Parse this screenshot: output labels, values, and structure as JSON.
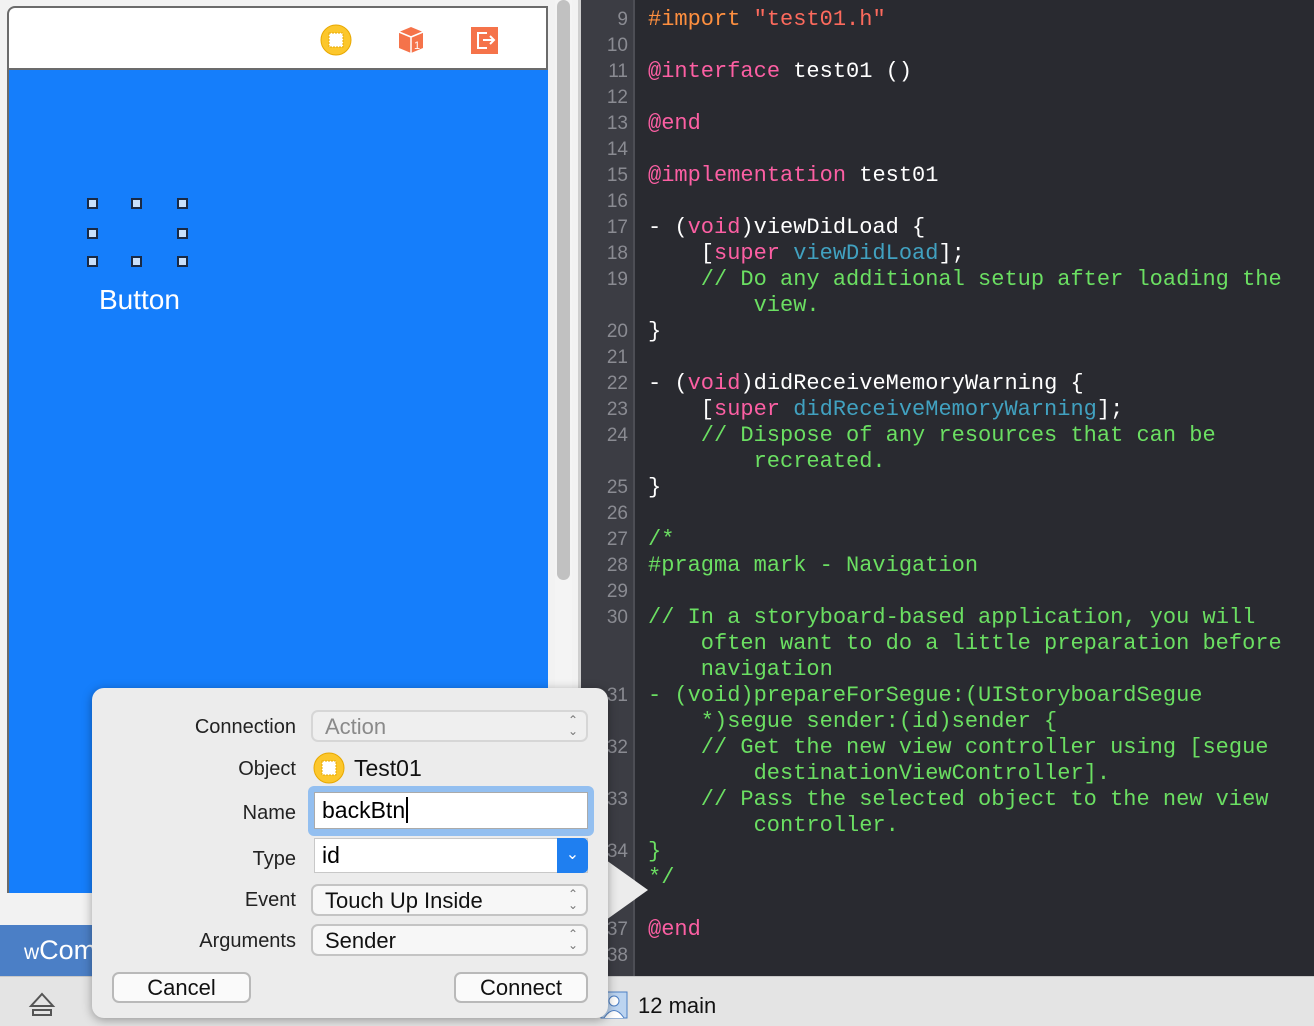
{
  "canvas": {
    "button_label": "Button",
    "scene_icons": [
      "view-controller-icon",
      "first-responder-icon",
      "exit-icon"
    ],
    "view_color": "#157efb"
  },
  "bottom_left": {
    "label_prefix": "w",
    "label": "Com"
  },
  "status_bar": {
    "branch_label": "12 main"
  },
  "popover": {
    "connection": {
      "label": "Connection",
      "value": "Action"
    },
    "object": {
      "label": "Object",
      "value": "Test01"
    },
    "name": {
      "label": "Name",
      "value": "backBtn"
    },
    "type": {
      "label": "Type",
      "value": "id"
    },
    "event": {
      "label": "Event",
      "value": "Touch Up Inside"
    },
    "arguments": {
      "label": "Arguments",
      "value": "Sender"
    },
    "cancel_label": "Cancel",
    "connect_label": "Connect"
  },
  "colors": {
    "keyword": "#fc5fa3",
    "string": "#fc6a5d",
    "preproc": "#fd8f3f",
    "comment": "#6bdf62",
    "method": "#41a1c0",
    "plain": "#ffffff"
  },
  "code_rows": [
    {
      "n": "9",
      "indent": 0,
      "t": [
        [
          "#import ",
          "preproc"
        ],
        [
          "\"test01.h\"",
          "string"
        ]
      ]
    },
    {
      "n": "10",
      "indent": 0,
      "t": []
    },
    {
      "n": "11",
      "indent": 0,
      "t": [
        [
          "@interface",
          "keyword"
        ],
        [
          " test01 ()",
          "plain"
        ]
      ]
    },
    {
      "n": "12",
      "indent": 0,
      "t": []
    },
    {
      "n": "13",
      "indent": 0,
      "t": [
        [
          "@end",
          "keyword"
        ]
      ]
    },
    {
      "n": "14",
      "indent": 0,
      "t": []
    },
    {
      "n": "15",
      "indent": 0,
      "t": [
        [
          "@implementation",
          "keyword"
        ],
        [
          " test01",
          "plain"
        ]
      ]
    },
    {
      "n": "16",
      "indent": 0,
      "t": []
    },
    {
      "n": "17",
      "indent": 0,
      "t": [
        [
          "- (",
          "plain"
        ],
        [
          "void",
          "keyword"
        ],
        [
          ")viewDidLoad {",
          "plain"
        ]
      ]
    },
    {
      "n": "18",
      "indent": 4,
      "t": [
        [
          "[",
          "plain"
        ],
        [
          "super",
          "keyword"
        ],
        [
          " ",
          "plain"
        ],
        [
          "viewDidLoad",
          "method"
        ],
        [
          "];",
          "plain"
        ]
      ]
    },
    {
      "n": "19",
      "indent": 4,
      "t": [
        [
          "// Do any additional setup after loading the",
          "comment"
        ]
      ]
    },
    {
      "n": "",
      "indent": 8,
      "t": [
        [
          "view.",
          "comment"
        ]
      ]
    },
    {
      "n": "20",
      "indent": 0,
      "t": [
        [
          "}",
          "plain"
        ]
      ]
    },
    {
      "n": "21",
      "indent": 0,
      "t": []
    },
    {
      "n": "22",
      "indent": 0,
      "t": [
        [
          "- (",
          "plain"
        ],
        [
          "void",
          "keyword"
        ],
        [
          ")didReceiveMemoryWarning {",
          "plain"
        ]
      ]
    },
    {
      "n": "23",
      "indent": 4,
      "t": [
        [
          "[",
          "plain"
        ],
        [
          "super",
          "keyword"
        ],
        [
          " ",
          "plain"
        ],
        [
          "didReceiveMemoryWarning",
          "method"
        ],
        [
          "];",
          "plain"
        ]
      ]
    },
    {
      "n": "24",
      "indent": 4,
      "t": [
        [
          "// Dispose of any resources that can be",
          "comment"
        ]
      ]
    },
    {
      "n": "",
      "indent": 8,
      "t": [
        [
          "recreated.",
          "comment"
        ]
      ]
    },
    {
      "n": "25",
      "indent": 0,
      "t": [
        [
          "}",
          "plain"
        ]
      ]
    },
    {
      "n": "26",
      "indent": 0,
      "t": []
    },
    {
      "n": "27",
      "indent": 0,
      "t": [
        [
          "/*",
          "comment"
        ]
      ]
    },
    {
      "n": "28",
      "indent": 0,
      "t": [
        [
          "#pragma mark - Navigation",
          "comment"
        ]
      ]
    },
    {
      "n": "29",
      "indent": 0,
      "t": []
    },
    {
      "n": "30",
      "indent": 0,
      "t": [
        [
          "// In a storyboard-based application, you will",
          "comment"
        ]
      ]
    },
    {
      "n": "",
      "indent": 4,
      "t": [
        [
          "often want to do a little preparation before",
          "comment"
        ]
      ]
    },
    {
      "n": "",
      "indent": 4,
      "t": [
        [
          "navigation",
          "comment"
        ]
      ]
    },
    {
      "n": "31",
      "indent": 0,
      "t": [
        [
          "- (void)prepareForSegue:(UIStoryboardSegue",
          "comment"
        ]
      ]
    },
    {
      "n": "",
      "indent": 4,
      "t": [
        [
          "*)segue sender:(id)sender {",
          "comment"
        ]
      ]
    },
    {
      "n": "32",
      "indent": 4,
      "t": [
        [
          "// Get the new view controller using [segue",
          "comment"
        ]
      ]
    },
    {
      "n": "",
      "indent": 8,
      "t": [
        [
          "destinationViewController].",
          "comment"
        ]
      ]
    },
    {
      "n": "33",
      "indent": 4,
      "t": [
        [
          "// Pass the selected object to the new view",
          "comment"
        ]
      ]
    },
    {
      "n": "",
      "indent": 8,
      "t": [
        [
          "controller.",
          "comment"
        ]
      ]
    },
    {
      "n": "34",
      "indent": 0,
      "t": [
        [
          "}",
          "comment"
        ]
      ]
    },
    {
      "n": "",
      "indent": 0,
      "t": [
        [
          "*/",
          "comment"
        ]
      ]
    },
    {
      "n": "",
      "indent": 0,
      "t": []
    },
    {
      "n": "37",
      "indent": 0,
      "t": [
        [
          "@end",
          "keyword"
        ]
      ]
    },
    {
      "n": "38",
      "indent": 0,
      "t": []
    }
  ]
}
